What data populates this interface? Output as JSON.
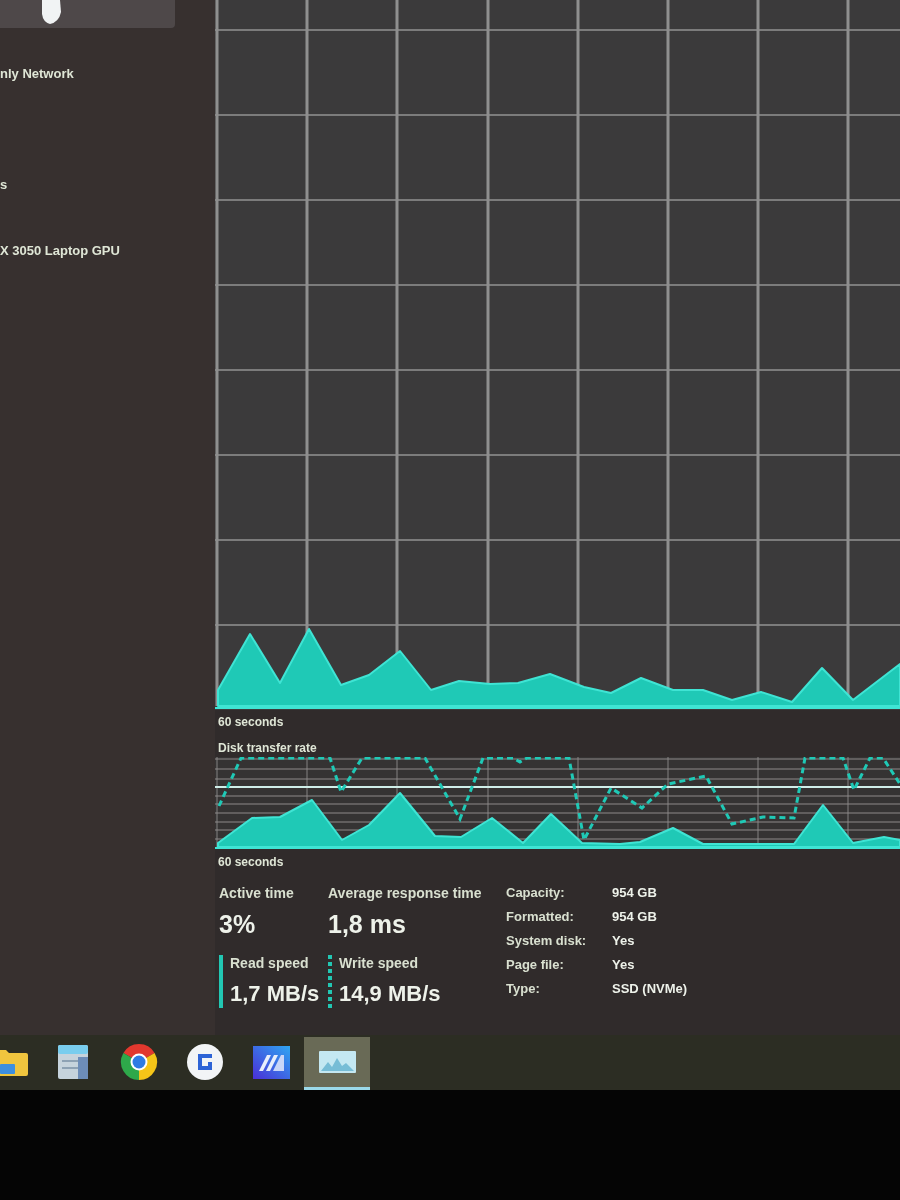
{
  "sidebar": {
    "items": [
      {
        "selected": true
      },
      {
        "subtitle": "nly Network",
        "selected": false
      },
      {
        "subtitle": "s",
        "selected": false
      },
      {
        "subtitle": "X 3050 Laptop GPU",
        "selected": false
      }
    ]
  },
  "activity_chart": {
    "time_label": "60 seconds"
  },
  "transfer_chart": {
    "title": "Disk transfer rate",
    "time_label": "60 seconds"
  },
  "stats": {
    "primary": [
      {
        "label": "Active time",
        "value": "3%"
      },
      {
        "label": "Average response time",
        "value": "1,8 ms"
      }
    ],
    "speeds": [
      {
        "kind": "solid",
        "label": "Read speed",
        "value": "1,7 MB/s"
      },
      {
        "kind": "dashed",
        "label": "Write speed",
        "value": "14,9 MB/s"
      }
    ],
    "properties": [
      {
        "label": "Capacity:",
        "value": "954 GB"
      },
      {
        "label": "Formatted:",
        "value": "954 GB"
      },
      {
        "label": "System disk:",
        "value": "Yes"
      },
      {
        "label": "Page file:",
        "value": "Yes"
      },
      {
        "label": "Type:",
        "value": "SSD (NVMe)"
      }
    ]
  },
  "taskbar": [
    {
      "kind": "folder",
      "selected": false
    },
    {
      "kind": "notepad",
      "selected": false
    },
    {
      "kind": "ring",
      "selected": false
    },
    {
      "kind": "circle",
      "selected": false
    },
    {
      "kind": "tile",
      "selected": false
    },
    {
      "kind": "monitor",
      "selected": true
    }
  ]
}
